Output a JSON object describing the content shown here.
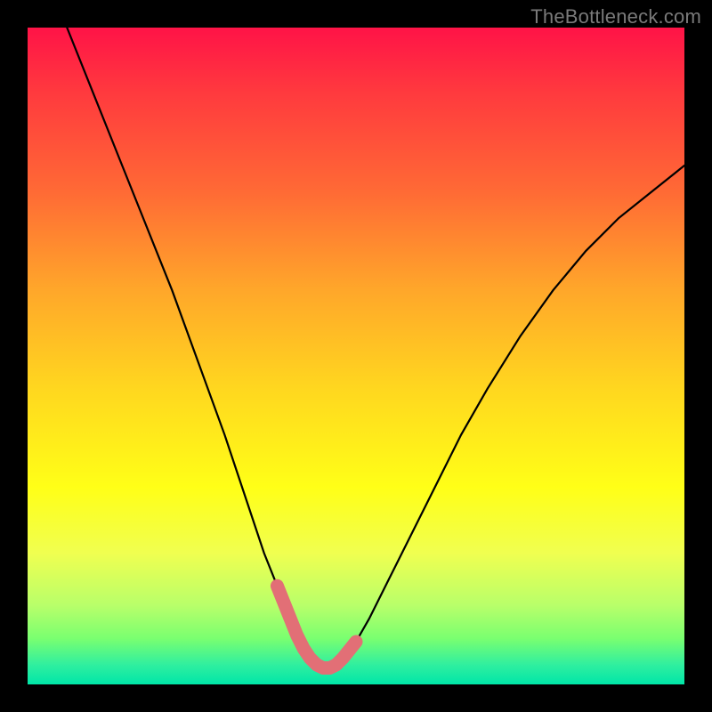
{
  "watermark": {
    "text": "TheBottleneck.com"
  },
  "colors": {
    "canvas_bg": "#000000",
    "curve_stroke": "#000000",
    "highlight_stroke": "#e26f76",
    "gradient_stops": [
      "#ff1347",
      "#ff3a3e",
      "#ff6a35",
      "#ffa72a",
      "#ffd71f",
      "#ffff17",
      "#f0ff50",
      "#b8ff6a",
      "#7aff70",
      "#30ef9f",
      "#00e6a8"
    ]
  },
  "chart_data": {
    "type": "line",
    "title": "",
    "xlabel": "",
    "ylabel": "",
    "xlim": [
      0,
      100
    ],
    "ylim": [
      0,
      100
    ],
    "grid": false,
    "legend": false,
    "series": [
      {
        "name": "bottleneck-curve",
        "x": [
          6,
          10,
          14,
          18,
          22,
          26,
          30,
          32,
          34,
          36,
          38,
          40,
          41,
          42,
          43,
          44,
          45,
          46,
          47,
          48,
          50,
          52,
          55,
          58,
          62,
          66,
          70,
          75,
          80,
          85,
          90,
          95,
          100
        ],
        "y": [
          100,
          90,
          80,
          70,
          60,
          49,
          38,
          32,
          26,
          20,
          15,
          10,
          7.5,
          5.5,
          4,
          3,
          2.5,
          2.5,
          3,
          4,
          6.5,
          10,
          16,
          22,
          30,
          38,
          45,
          53,
          60,
          66,
          71,
          75,
          79
        ]
      }
    ],
    "highlight": {
      "name": "valley-highlight",
      "x": [
        38,
        40,
        41,
        42,
        43,
        44,
        45,
        46,
        47,
        48,
        50
      ],
      "y": [
        15,
        10,
        7.5,
        5.5,
        4,
        3,
        2.5,
        2.5,
        3,
        4,
        6.5
      ]
    }
  }
}
